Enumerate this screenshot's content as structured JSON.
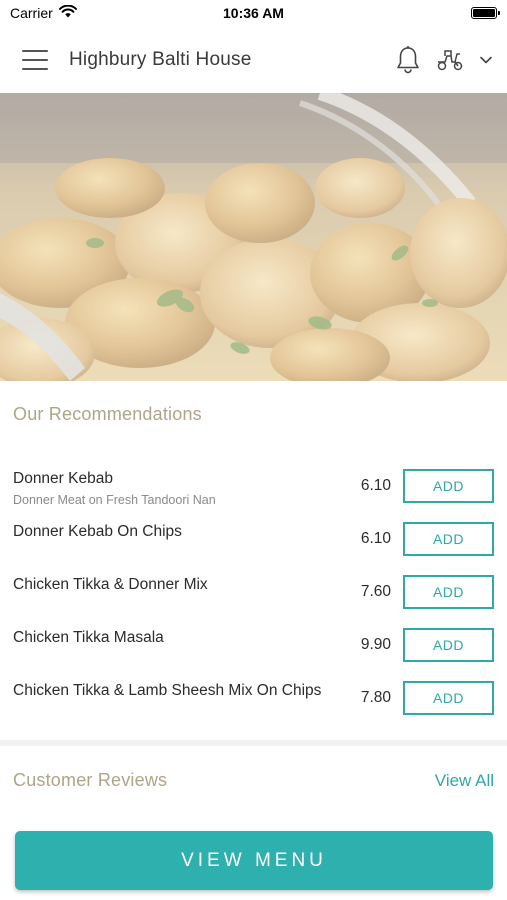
{
  "status_bar": {
    "carrier": "Carrier",
    "time": "10:36 AM"
  },
  "header": {
    "title": "Highbury Balti House",
    "icons": [
      "menu-icon",
      "bell-icon",
      "delivery-scooter-icon",
      "chevron-down-icon"
    ]
  },
  "recommendations": {
    "title": "Our Recommendations",
    "add_label": "ADD",
    "items": [
      {
        "name": "Donner Kebab",
        "description": "Donner Meat on Fresh Tandoori Nan",
        "price": "6.10"
      },
      {
        "name": "Donner Kebab On Chips",
        "description": "",
        "price": "6.10"
      },
      {
        "name": "Chicken Tikka & Donner Mix",
        "description": "",
        "price": "7.60"
      },
      {
        "name": "Chicken Tikka Masala",
        "description": "",
        "price": "9.90"
      },
      {
        "name": "Chicken Tikka & Lamb Sheesh Mix On Chips",
        "description": "",
        "price": "7.80"
      }
    ]
  },
  "reviews": {
    "title": "Customer Reviews",
    "view_all": "View All"
  },
  "view_menu_label": "VIEW MENU",
  "colors": {
    "accent": "#2eb0ae",
    "section_title": "#b0a488"
  }
}
